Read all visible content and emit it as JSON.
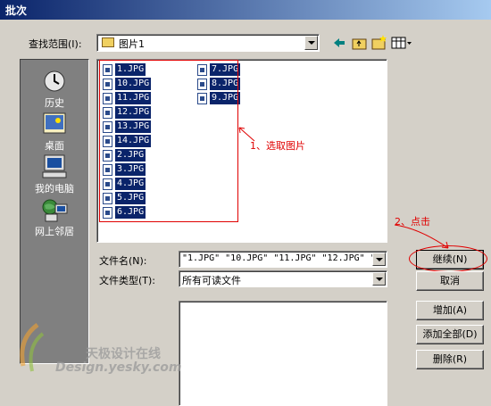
{
  "window": {
    "title": "批次"
  },
  "look_in": {
    "label": "查找范围(I):",
    "value": "图片1"
  },
  "toolbar": {
    "icons": [
      "back-arrow-icon",
      "up-folder-icon",
      "new-folder-icon",
      "view-menu-icon"
    ]
  },
  "places": [
    {
      "label": "历史",
      "icon": "history-icon"
    },
    {
      "label": "桌面",
      "icon": "desktop-icon"
    },
    {
      "label": "我的电脑",
      "icon": "my-computer-icon"
    },
    {
      "label": "网上邻居",
      "icon": "network-icon"
    }
  ],
  "files": {
    "column1": [
      "1.JPG",
      "10.JPG",
      "11.JPG",
      "12.JPG",
      "13.JPG",
      "14.JPG",
      "2.JPG",
      "3.JPG",
      "4.JPG",
      "5.JPG",
      "6.JPG"
    ],
    "column2": [
      "7.JPG",
      "8.JPG",
      "9.JPG"
    ]
  },
  "filename": {
    "label": "文件名(N):",
    "value": "\"1.JPG\" \"10.JPG\" \"11.JPG\" \"12.JPG\" \"13"
  },
  "filetype": {
    "label": "文件类型(T):",
    "value": "所有可读文件"
  },
  "buttons": {
    "continue": "继续(N)",
    "cancel": "取消",
    "add": "增加(A)",
    "add_all": "添加全部(D)",
    "delete": "删除(R)"
  },
  "annotations": {
    "step1": "1、选取图片",
    "step2": "2、点击"
  },
  "watermark": {
    "cn": "天极设计在线",
    "en": "Design.yesky.com"
  }
}
